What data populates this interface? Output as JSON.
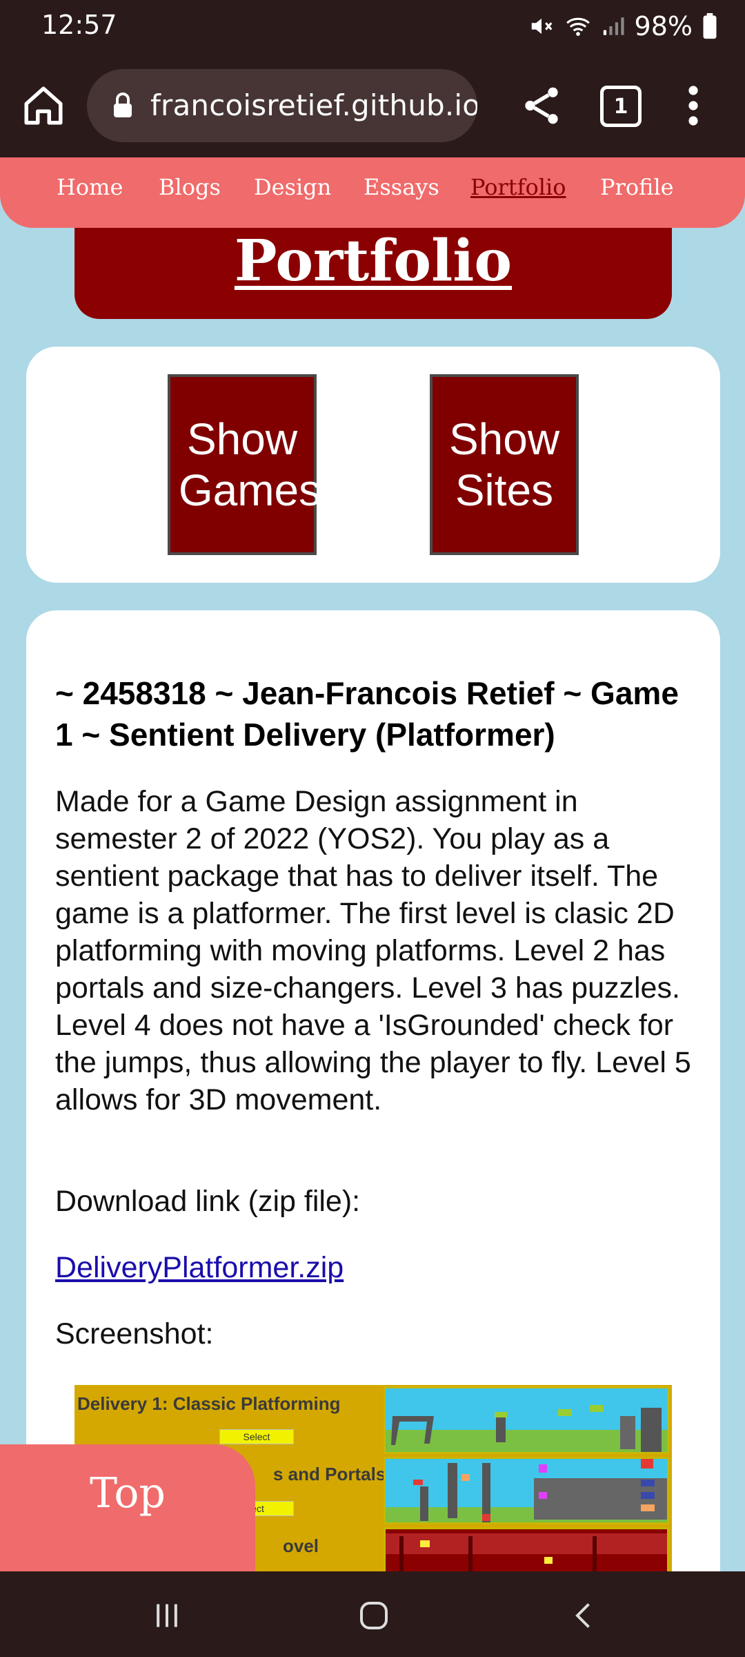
{
  "status_bar": {
    "time": "12:57",
    "battery_percent": "98%",
    "icons": [
      "mute-icon",
      "wifi-icon",
      "signal-icon",
      "battery-icon"
    ]
  },
  "browser": {
    "url": "francoisretief.github.io",
    "tab_count": "1",
    "icons": [
      "home-icon",
      "lock-icon",
      "share-icon",
      "tabs-icon",
      "more-vert-icon"
    ]
  },
  "site_nav": {
    "items": [
      {
        "label": "Home",
        "active": false
      },
      {
        "label": "Blogs",
        "active": false
      },
      {
        "label": "Design",
        "active": false
      },
      {
        "label": "Essays",
        "active": false
      },
      {
        "label": "Portfolio",
        "active": true
      },
      {
        "label": "Profile",
        "active": false
      }
    ]
  },
  "header": {
    "title": "Portfolio"
  },
  "filters": {
    "games_line1": "Show",
    "games_line2": "Games",
    "sites_line1": "Show",
    "sites_line2": "Sites"
  },
  "content": {
    "title": "~ 2458318 ~ Jean-Francois Retief ~ Game 1 ~ Sentient Delivery (Platformer)",
    "description": "Made for a Game Design assignment in semester 2 of 2022 (YOS2). You play as a sentient package that has to deliver itself. The game is a platformer. The first level is clasic 2D platforming with moving platforms. Level 2 has portals and size-changers. Level 3 has puzzles. Level 4 does not have a 'IsGrounded' check for the jumps, thus allowing the player to fly. Level 5 allows for 3D movement.",
    "download_label": "Download link (zip file):",
    "download_link": "DeliveryPlatformer.zip",
    "screenshot_label": "Screenshot:"
  },
  "screenshot": {
    "row1_title": "Delivery 1: Classic Platforming",
    "row2_title_visible": "s and Portals",
    "row3_title_visible": "ovel",
    "select_label": "Select",
    "select_label_partial": "lect"
  },
  "top_button": {
    "label": "Top"
  },
  "system_nav": {
    "icons": [
      "recents-icon",
      "home-circle-icon",
      "back-icon"
    ]
  },
  "colors": {
    "page_bg": "#add8e6",
    "nav_coral": "#f06b6b",
    "maroon": "#8b0000",
    "link_blue": "#1a0dab",
    "chrome_dark": "#2a1a1a"
  }
}
